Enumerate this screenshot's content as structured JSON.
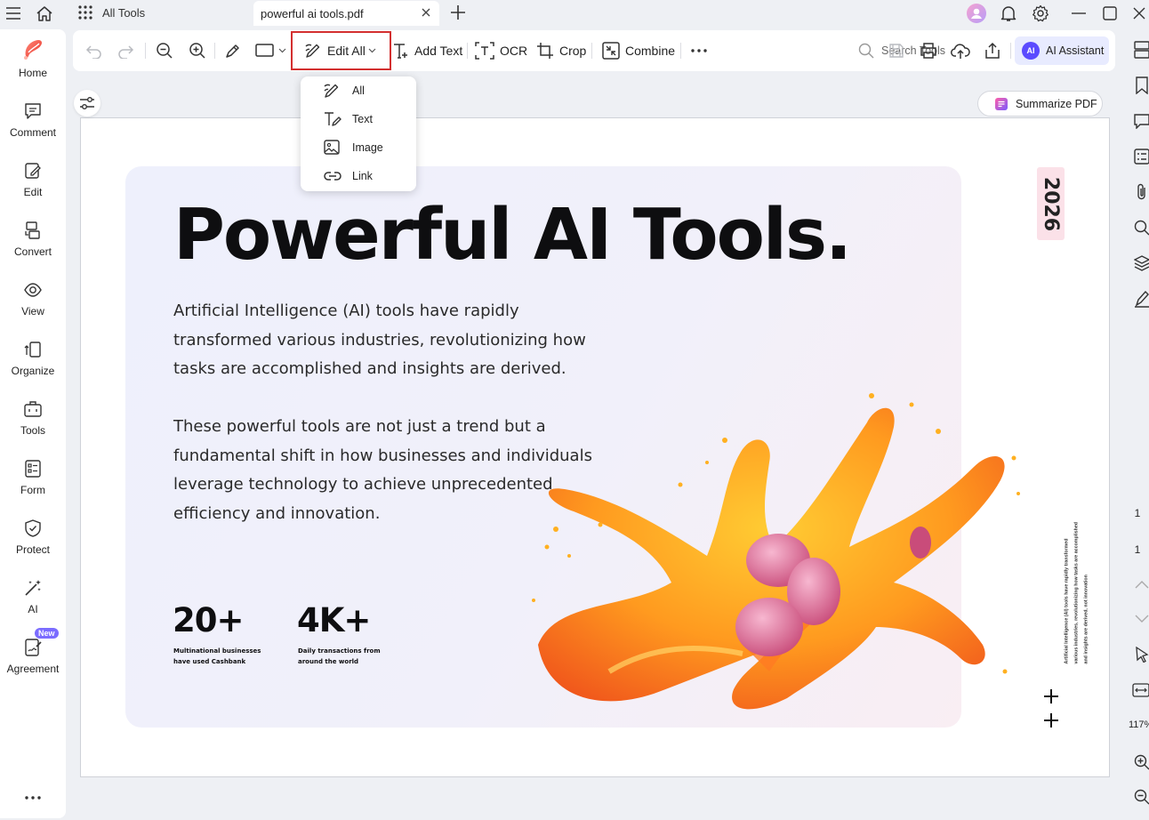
{
  "titlebar": {
    "all_tools": "All Tools",
    "file_tab": "powerful ai tools.pdf"
  },
  "nav": {
    "items": [
      {
        "label": "Home",
        "icon": "home-logo-icon"
      },
      {
        "label": "Comment",
        "icon": "comment-icon"
      },
      {
        "label": "Edit",
        "icon": "edit-icon"
      },
      {
        "label": "Convert",
        "icon": "convert-icon"
      },
      {
        "label": "View",
        "icon": "view-icon"
      },
      {
        "label": "Organize",
        "icon": "organize-icon"
      },
      {
        "label": "Tools",
        "icon": "tools-icon"
      },
      {
        "label": "Form",
        "icon": "form-icon"
      },
      {
        "label": "Protect",
        "icon": "protect-icon"
      },
      {
        "label": "AI",
        "icon": "ai-icon"
      },
      {
        "label": "Agreement",
        "icon": "agreement-icon",
        "badge": "New"
      }
    ]
  },
  "toolbar": {
    "edit_all": "Edit All",
    "add_text": "Add Text",
    "ocr": "OCR",
    "crop": "Crop",
    "combine": "Combine",
    "search_placeholder": "Search Tools",
    "ai_assistant": "AI Assistant",
    "ai_badge": "AI"
  },
  "edit_menu": {
    "items": [
      "All",
      "Text",
      "Image",
      "Link"
    ]
  },
  "summarize": "Summarize PDF",
  "document": {
    "title": "Powerful AI Tools.",
    "para1": "Artificial Intelligence (AI) tools have rapidly transformed various industries, revolutionizing how tasks are accomplished and insights are derived.",
    "para2": "These powerful tools are not just a trend but a fundamental shift in how businesses and individuals leverage technology to achieve unprecedented efficiency and innovation.",
    "stat1_value": "20+",
    "stat1_label": "Multinational businesses have used Cashbank",
    "stat2_value": "4K+",
    "stat2_label": "Daily transactions from around the world",
    "year": "2026",
    "side_text": "Artificial Intelligence (AI) tools have rapidly transformed various industries, revolutionizing how tasks are accomplished and insights are derived, not innovation"
  },
  "right_rail": {
    "page_current": "1",
    "page_total": "1",
    "zoom": "117%"
  }
}
